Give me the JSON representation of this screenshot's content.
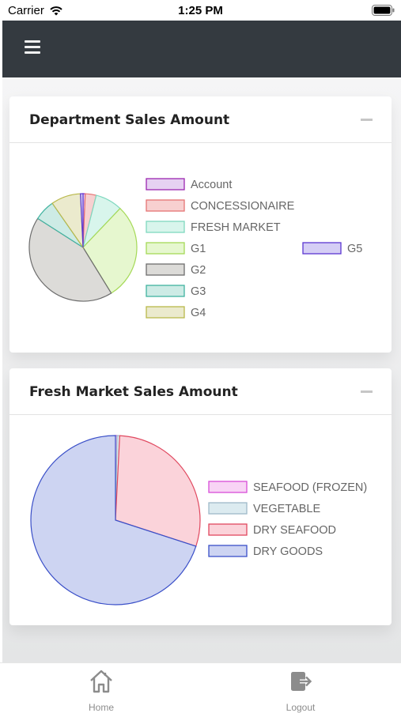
{
  "status_bar": {
    "carrier": "Carrier",
    "time": "1:25 PM"
  },
  "header": {
    "menu_icon": "hamburger-icon"
  },
  "cards": [
    {
      "title": "Department Sales Amount",
      "collapse_icon": "minus-icon",
      "chart_data": {
        "type": "pie",
        "slices": [
          {
            "label": "Account",
            "value": 0.6,
            "color": "#9c27b0",
            "fill": "#e6d1f2"
          },
          {
            "label": "CONCESSIONAIRE",
            "value": 3,
            "color": "#e57373",
            "fill": "#f7d0d0"
          },
          {
            "label": "FRESH MARKET",
            "value": 7.4,
            "color": "#7fd8bf",
            "fill": "#d8f5ec"
          },
          {
            "label": "G1",
            "value": 26.5,
            "color": "#a5d957",
            "fill": "#e6f7cf"
          },
          {
            "label": "G2",
            "value": 39,
            "color": "#6d6d6d",
            "fill": "#dcdbd8"
          },
          {
            "label": "G3",
            "value": 5.7,
            "color": "#40b3a0",
            "fill": "#cdebe5"
          },
          {
            "label": "G4",
            "value": 8.1,
            "color": "#b9b84a",
            "fill": "#ebeacd"
          },
          {
            "label": "G5",
            "value": 0.7,
            "color": "#5b36d1",
            "fill": "#d5cef5"
          }
        ]
      }
    },
    {
      "title": "Fresh Market Sales Amount",
      "collapse_icon": "minus-icon",
      "chart_data": {
        "type": "pie",
        "slices": [
          {
            "label": "SEAFOOD (FROZEN)",
            "value": 0.3,
            "color": "#d84dd8",
            "fill": "#f8d4f5"
          },
          {
            "label": "VEGETABLE",
            "value": 0.5,
            "color": "#9fb9c9",
            "fill": "#dcebf0"
          },
          {
            "label": "DRY SEAFOOD",
            "value": 29.2,
            "color": "#e0485f",
            "fill": "#fbd3da"
          },
          {
            "label": "DRY GOODS",
            "value": 70,
            "color": "#3a4fc8",
            "fill": "#cdd4f2"
          }
        ]
      }
    }
  ],
  "bottom_nav": {
    "home": {
      "label": "Home",
      "icon": "home-icon"
    },
    "logout": {
      "label": "Logout",
      "icon": "logout-icon"
    }
  }
}
